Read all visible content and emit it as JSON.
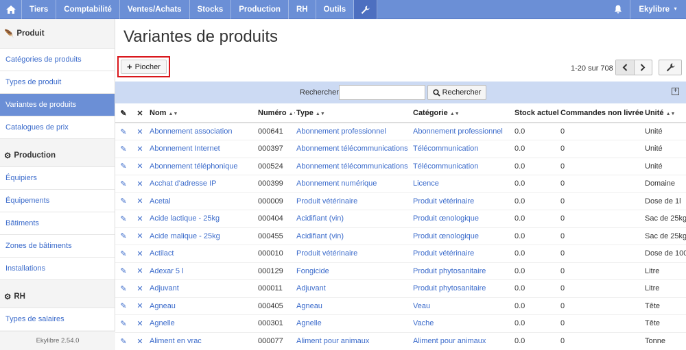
{
  "nav": {
    "items": [
      "Tiers",
      "Comptabilité",
      "Ventes/Achats",
      "Stocks",
      "Production",
      "RH",
      "Outils"
    ],
    "user": "Ekylibre"
  },
  "sidebar": {
    "sections": [
      {
        "title": "Produit",
        "icon": "feather-icon",
        "items": [
          {
            "label": "Catégories de produits",
            "active": false
          },
          {
            "label": "Types de produit",
            "active": false
          },
          {
            "label": "Variantes de produits",
            "active": true
          },
          {
            "label": "Catalogues de prix",
            "active": false
          }
        ]
      },
      {
        "title": "Production",
        "icon": "cogs-icon",
        "items": [
          {
            "label": "Équipiers",
            "active": false
          },
          {
            "label": "Équipements",
            "active": false
          },
          {
            "label": "Bâtiments",
            "active": false
          },
          {
            "label": "Zones de bâtiments",
            "active": false
          },
          {
            "label": "Installations",
            "active": false
          }
        ]
      },
      {
        "title": "RH",
        "icon": "gear-icon",
        "items": [
          {
            "label": "Types de salaires",
            "active": false
          }
        ]
      }
    ],
    "version": "Ekylibre 2.54.0"
  },
  "main": {
    "title": "Variantes de produits",
    "pick_label": "Piocher",
    "pagination": "1-20 sur 708",
    "search": {
      "label": "Rechercher",
      "value": "",
      "button": "Rechercher"
    }
  },
  "table": {
    "columns": [
      "Nom",
      "Numéro",
      "Type",
      "Catégorie",
      "Stock actuel",
      "Commandes non livrées",
      "Unité"
    ],
    "rows": [
      [
        "Abonnement association",
        "000641",
        "Abonnement professionnel",
        "Abonnement professionnel",
        "0.0",
        "0",
        "Unité"
      ],
      [
        "Abonnement Internet",
        "000397",
        "Abonnement télécommunications",
        "Télécommunication",
        "0.0",
        "0",
        "Unité"
      ],
      [
        "Abonnement téléphonique",
        "000524",
        "Abonnement télécommunications",
        "Télécommunication",
        "0.0",
        "0",
        "Unité"
      ],
      [
        "Acchat d'adresse IP",
        "000399",
        "Abonnement numérique",
        "Licence",
        "0.0",
        "0",
        "Domaine"
      ],
      [
        "Acetal",
        "000009",
        "Produit vétérinaire",
        "Produit vétérinaire",
        "0.0",
        "0",
        "Dose de 1l"
      ],
      [
        "Acide lactique - 25kg",
        "000404",
        "Acidifiant (vin)",
        "Produit œnologique",
        "0.0",
        "0",
        "Sac de 25kg"
      ],
      [
        "Acide malique - 25kg",
        "000455",
        "Acidifiant (vin)",
        "Produit œnologique",
        "0.0",
        "0",
        "Sac de 25kg"
      ],
      [
        "Actilact",
        "000010",
        "Produit vétérinaire",
        "Produit vétérinaire",
        "0.0",
        "0",
        "Dose de 100"
      ],
      [
        "Adexar 5 l",
        "000129",
        "Fongicide",
        "Produit phytosanitaire",
        "0.0",
        "0",
        "Litre"
      ],
      [
        "Adjuvant",
        "000011",
        "Adjuvant",
        "Produit phytosanitaire",
        "0.0",
        "0",
        "Litre"
      ],
      [
        "Agneau",
        "000405",
        "Agneau",
        "Veau",
        "0.0",
        "0",
        "Tête"
      ],
      [
        "Agnelle",
        "000301",
        "Agnelle",
        "Vache",
        "0.0",
        "0",
        "Tête"
      ],
      [
        "Aliment en vrac",
        "000077",
        "Aliment pour animaux",
        "Aliment pour animaux",
        "0.0",
        "0",
        "Tonne"
      ]
    ]
  },
  "colors": {
    "nav": "#6b8fd6",
    "link": "#3b6bcb",
    "search_band": "#ccdaf3",
    "highlight": "#d9161b"
  }
}
